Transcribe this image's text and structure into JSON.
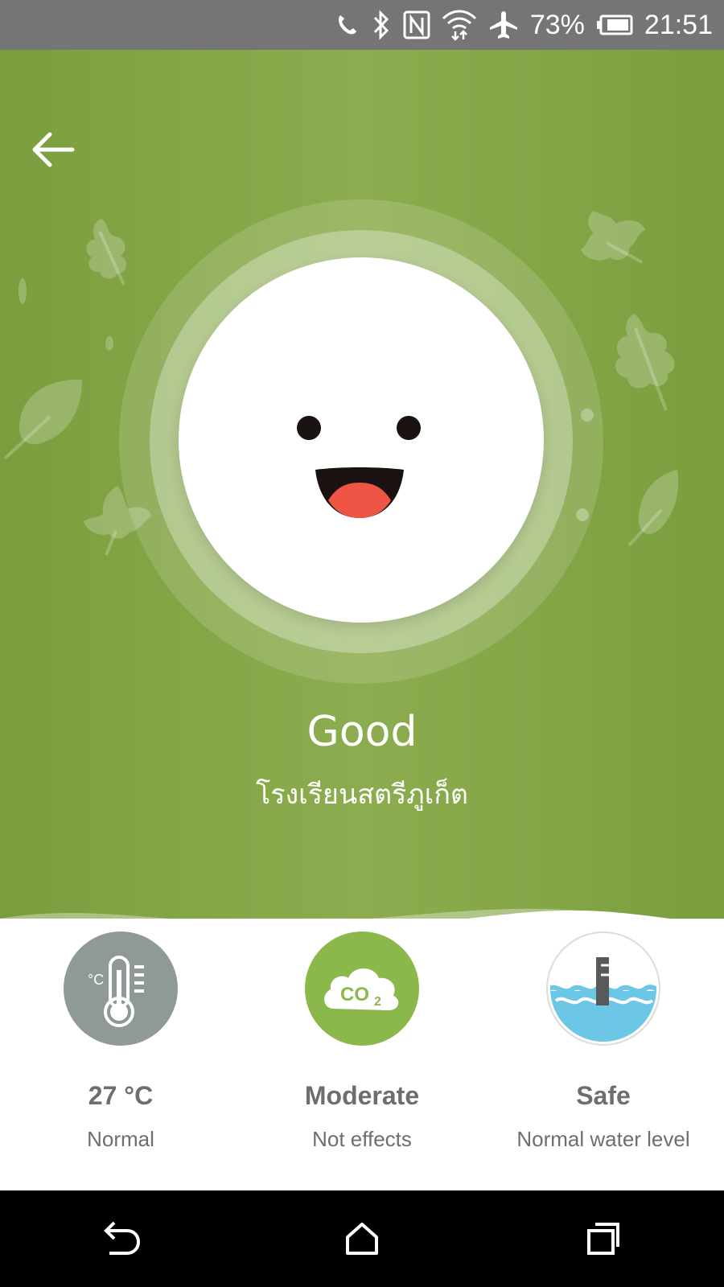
{
  "status_bar": {
    "battery_percent": "73%",
    "time": "21:51"
  },
  "hero": {
    "quality_label": "Good",
    "location": "โรงเรียนสตรีภูเก็ต",
    "background_color": "#86a84a",
    "mouth_tongue_color": "#ee5544"
  },
  "metrics": [
    {
      "icon": "thermometer-icon",
      "value": "27 °C",
      "sub": "Normal",
      "badge_color": "#8f9998"
    },
    {
      "icon": "co2-cloud-icon",
      "value": "Moderate",
      "sub": "Not effects",
      "badge_color": "#8ab84a"
    },
    {
      "icon": "water-level-icon",
      "value": "Safe",
      "sub": "Normal water level",
      "badge_color": "#ffffff"
    }
  ]
}
